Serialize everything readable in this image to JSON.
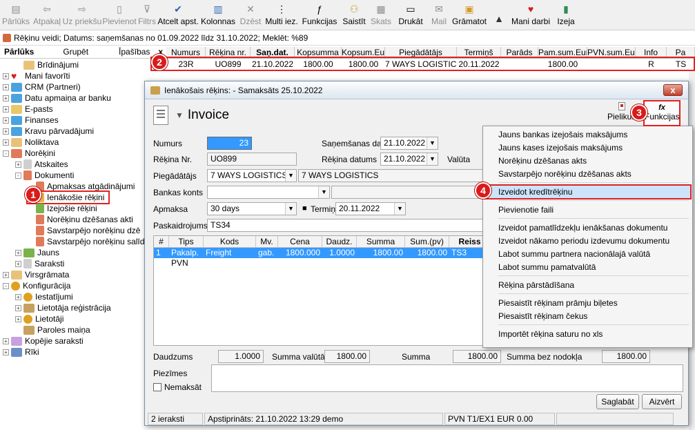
{
  "toolbar": {
    "items": [
      {
        "label": "Pārlūks",
        "icon": "browser-icon",
        "disabled": true
      },
      {
        "label": "Atpakaļ",
        "icon": "back-arrow-icon",
        "disabled": true
      },
      {
        "label": "Uz priekšu",
        "icon": "forward-arrow-icon",
        "disabled": true
      },
      {
        "label": "Pievienot",
        "icon": "add-document-icon",
        "disabled": true
      },
      {
        "label": "Filtrs",
        "icon": "filter-icon",
        "disabled": true
      },
      {
        "label": "Atcelt apst.",
        "icon": "checkmark-pen-icon",
        "disabled": false
      },
      {
        "label": "Kolonnas",
        "icon": "columns-icon",
        "disabled": false
      },
      {
        "label": "Dzēst",
        "icon": "delete-x-icon",
        "disabled": true
      },
      {
        "label": "Multi iez.",
        "icon": "dots-icon",
        "disabled": false
      },
      {
        "label": "Funkcijas",
        "icon": "function-icon",
        "disabled": false
      },
      {
        "label": "Saistīt",
        "icon": "link-icon",
        "disabled": false
      },
      {
        "label": "Skats",
        "icon": "view-icon",
        "disabled": true
      },
      {
        "label": "Drukāt",
        "icon": "printer-icon",
        "disabled": false
      },
      {
        "label": "Mail",
        "icon": "mail-icon",
        "disabled": true
      },
      {
        "label": "Grāmatot",
        "icon": "book-icon",
        "disabled": false
      },
      {
        "label": "",
        "icon": "bell-icon",
        "disabled": false
      },
      {
        "label": "Mani darbi",
        "icon": "heart-icon",
        "disabled": false
      },
      {
        "label": "Izeja",
        "icon": "exit-door-icon",
        "disabled": false
      }
    ]
  },
  "status_line": "Rēķinu veidi; Datums: saņemšanas no 01.09.2022 līdz 31.10.2022; Meklēt: %89",
  "left_tabs": [
    "Pārlūks",
    "Grupēt",
    "Īpašības"
  ],
  "close_glyph": "x",
  "tree": [
    {
      "label": "Brīdinājumi",
      "level": 1,
      "pm": "",
      "icon": "home",
      "color": "#e9c27a"
    },
    {
      "label": "Mani favorīti",
      "level": 0,
      "pm": "+",
      "icon": "heart",
      "color": "#d41f1f"
    },
    {
      "label": "CRM (Partneri)",
      "level": 0,
      "pm": "+",
      "icon": "folder",
      "color": "#4aa3df"
    },
    {
      "label": "Datu apmaiņa ar banku",
      "level": 0,
      "pm": "+",
      "icon": "folder",
      "color": "#4aa3df"
    },
    {
      "label": "E-pasts",
      "level": 0,
      "pm": "+",
      "icon": "mail",
      "color": "#e8c86b"
    },
    {
      "label": "Finanses",
      "level": 0,
      "pm": "+",
      "icon": "folder",
      "color": "#4aa3df"
    },
    {
      "label": "Kravu pārvadājumi",
      "level": 0,
      "pm": "+",
      "icon": "folder",
      "color": "#4aa3df"
    },
    {
      "label": "Noliktava",
      "level": 0,
      "pm": "+",
      "icon": "folder",
      "color": "#e9c27a"
    },
    {
      "label": "Norēķini",
      "level": 0,
      "pm": "-",
      "icon": "folder",
      "color": "#e07a5a"
    },
    {
      "label": "Atskaites",
      "level": 1,
      "pm": "+",
      "icon": "list",
      "color": "#cfcfcf"
    },
    {
      "label": "Dokumenti",
      "level": 1,
      "pm": "-",
      "icon": "doc",
      "color": "#e07a5a"
    },
    {
      "label": "Apmaksas atgādinājumi",
      "level": 2,
      "pm": "",
      "icon": "doc",
      "color": "#e07a5a"
    },
    {
      "label": "Ienākošie rēķini",
      "level": 2,
      "pm": "",
      "icon": "doc",
      "color": "#e9b14a"
    },
    {
      "label": "Izejošie rēķini",
      "level": 2,
      "pm": "",
      "icon": "doc",
      "color": "#7ab34a"
    },
    {
      "label": "Norēķinu dzēšanas akti",
      "level": 2,
      "pm": "",
      "icon": "doc",
      "color": "#e07a5a"
    },
    {
      "label": "Savstarpējo norēķinu dzē",
      "level": 2,
      "pm": "",
      "icon": "doc",
      "color": "#e07a5a"
    },
    {
      "label": "Savstarpējo norēķinu salīd",
      "level": 2,
      "pm": "",
      "icon": "doc",
      "color": "#e07a5a"
    },
    {
      "label": "Jauns",
      "level": 1,
      "pm": "+",
      "icon": "new",
      "color": "#7ab34a"
    },
    {
      "label": "Saraksti",
      "level": 1,
      "pm": "+",
      "icon": "list",
      "color": "#cfcfcf"
    },
    {
      "label": "Virsgrāmata",
      "level": 0,
      "pm": "+",
      "icon": "folder",
      "color": "#e9c27a"
    },
    {
      "label": "Konfigurācija",
      "level": 0,
      "pm": "-",
      "icon": "gear",
      "color": "#e0a020"
    },
    {
      "label": "Iestatījumi",
      "level": 1,
      "pm": "+",
      "icon": "gear",
      "color": "#e0a020"
    },
    {
      "label": "Lietotāja reģistrācija",
      "level": 1,
      "pm": "+",
      "icon": "key",
      "color": "#c8a060"
    },
    {
      "label": "Lietotāji",
      "level": 1,
      "pm": "+",
      "icon": "gear",
      "color": "#e0a020"
    },
    {
      "label": "Paroles maiņa",
      "level": 1,
      "pm": "",
      "icon": "key",
      "color": "#c8a060"
    },
    {
      "label": "Kopējie saraksti",
      "level": 0,
      "pm": "+",
      "icon": "grid",
      "color": "#c9a0e0"
    },
    {
      "label": "Rīki",
      "level": 0,
      "pm": "+",
      "icon": "tools",
      "color": "#6b8fc9"
    }
  ],
  "grid": {
    "headers": [
      "Numurs",
      "Rēķina nr.",
      "Saņ.dat.",
      "Kopsumma",
      "Kopsum.Eur",
      "Piegādātājs",
      "Termiņš",
      "Parāds",
      "Pam.sum.Eur",
      "PVN.sum.Eur",
      "Info",
      "Pa"
    ],
    "row": [
      "23R",
      "UO899",
      "21.10.2022",
      "1800.00",
      "1800.00",
      "7 WAYS LOGISTICS",
      "20.11.2022",
      "",
      "1800.00",
      "",
      "R",
      "TS"
    ]
  },
  "badges": [
    "1",
    "2",
    "3",
    "4"
  ],
  "dialog": {
    "title": "Ienākošais rēķins:  - Samaksāts 25.10.2022",
    "close": "x",
    "header": "Invoice",
    "caret": "▼",
    "attachments_label": "Pielikumi",
    "functions_label": "Funkcijas",
    "functions_glyph": "fx",
    "labels": {
      "numurs": "Numurs",
      "rekina_nr": "Rēķina Nr.",
      "piegadatajs": "Piegādātājs",
      "bankas_konts": "Bankas konts",
      "apmaksa": "Apmaksa",
      "paskaidrojums": "Paskaidrojums",
      "sanemsanas_dat": "Saņemšanas dat.",
      "rekina_datums": "Rēķina datums",
      "valuta": "Valūta",
      "termins": "Termiņš",
      "daudzums": "Daudzums",
      "summa_valuta": "Summa valūtā",
      "summa": "Summa",
      "summa_bez_nodokla": "Summa bez nodokļa",
      "piezimes": "Piezīmes",
      "nemaksat": "Nemaksāt"
    },
    "values": {
      "numurs": "23",
      "rekina_nr": "UO899",
      "piegadatajs_code": "7 WAYS LOGISTICS",
      "piegadatajs_name": "7 WAYS LOGISTICS",
      "bankas_konts": "",
      "apmaksa": "30 days",
      "paskaidrojums": "TS34",
      "sanemsanas_dat": "21.10.2022",
      "rekina_datums": "21.10.2022",
      "termins": "20.11.2022",
      "daudzums": "1.0000",
      "summa_valuta": "1800.00",
      "summa": "1800.00",
      "summa_bez_nodokla": "1800.00"
    },
    "lines": {
      "headers": [
        "#",
        "Tips",
        "Kods",
        "Mv.",
        "Cena",
        "Daudz.",
        "Summa",
        "Sum.(pv)",
        "Reiss"
      ],
      "rows": [
        [
          "1",
          "Pakalp.",
          "Freight",
          "gab.",
          "1800.000",
          "1.0000",
          "1800.00",
          "1800.00",
          "TS3"
        ],
        [
          "",
          "PVN",
          "",
          "",
          "",
          "",
          "",
          "",
          ""
        ]
      ]
    },
    "buttons": {
      "save": "Saglabāt",
      "close": "Aizvērt"
    },
    "statusbar": [
      "2 ieraksti",
      "Apstiprināts: 21.10.2022 13:29 demo",
      "PVN T1/EX1 EUR 0.00",
      ""
    ]
  },
  "menu": {
    "items": [
      "Jauns bankas izejošais maksājums",
      "Jauns kases izejošais maksājums",
      "Norēķinu dzēšanas akts",
      "Savstarpējo norēķinu dzēšanas akts",
      "Izveidot kredītrēķinu",
      "Pievienotie faili",
      "Izveidot pamatlīdzekļu ienākšanas dokumentu",
      "Izveidot nākamo periodu izdevumu dokumentu",
      "Labot summu partnera nacionālajā valūtā",
      "Labot summu pamatvalūtā",
      "Rēķina pārstādīšana",
      "Piesaistīt rēķinam prāmju biļetes",
      "Piesaistīt rēķinam čekus",
      "Importēt rēķina saturu no xls"
    ]
  }
}
